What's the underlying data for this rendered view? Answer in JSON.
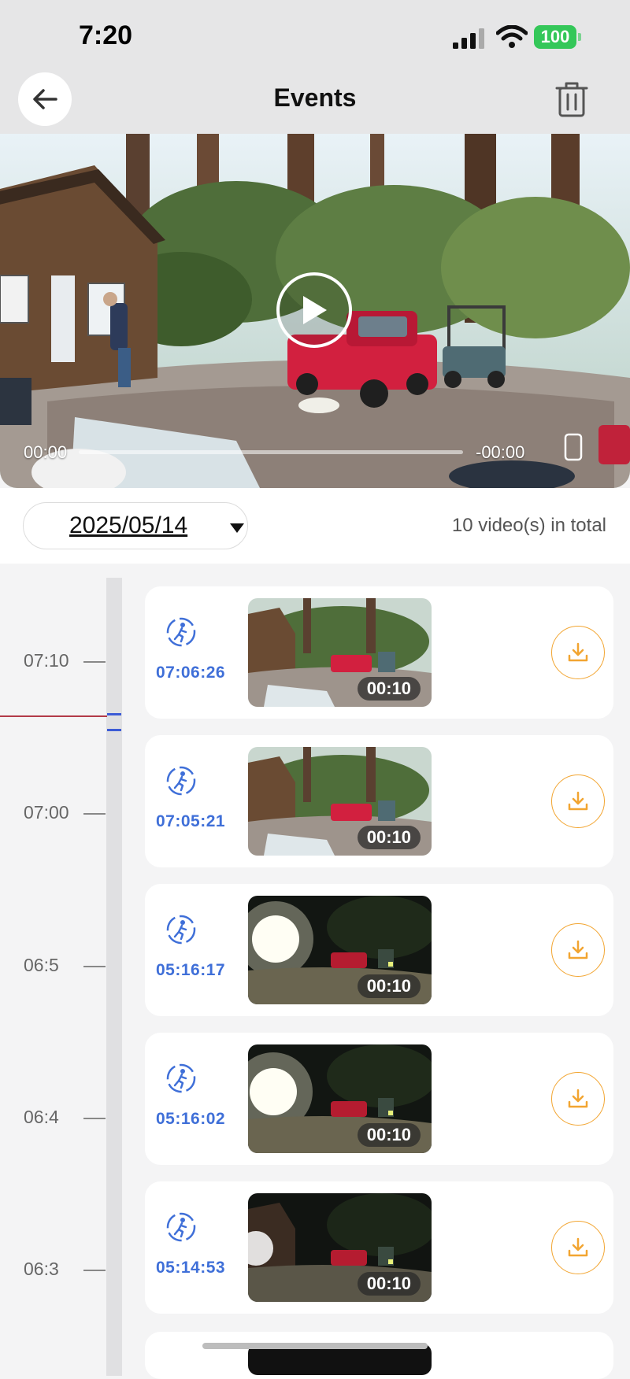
{
  "status": {
    "time": "7:20",
    "battery": "100"
  },
  "header": {
    "title": "Events",
    "back_icon": "arrow-left-icon",
    "delete_icon": "trash-icon"
  },
  "player": {
    "time_start": "00:00",
    "time_end": "-00:00"
  },
  "filter": {
    "date": "2025/05/14",
    "total": "10 video(s) in total"
  },
  "timeline": {
    "ticks": [
      "07:10",
      "07:00",
      "06:5",
      "06:4",
      "06:3"
    ]
  },
  "events": [
    {
      "time": "07:06:26",
      "duration": "00:10",
      "scene": "day"
    },
    {
      "time": "07:05:21",
      "duration": "00:10",
      "scene": "day"
    },
    {
      "time": "05:16:17",
      "duration": "00:10",
      "scene": "night"
    },
    {
      "time": "05:16:02",
      "duration": "00:10",
      "scene": "night"
    },
    {
      "time": "05:14:53",
      "duration": "00:10",
      "scene": "night"
    }
  ],
  "colors": {
    "accent_blue": "#3f6fd8",
    "download_orange": "#f2a531",
    "battery_green": "#34c759"
  }
}
